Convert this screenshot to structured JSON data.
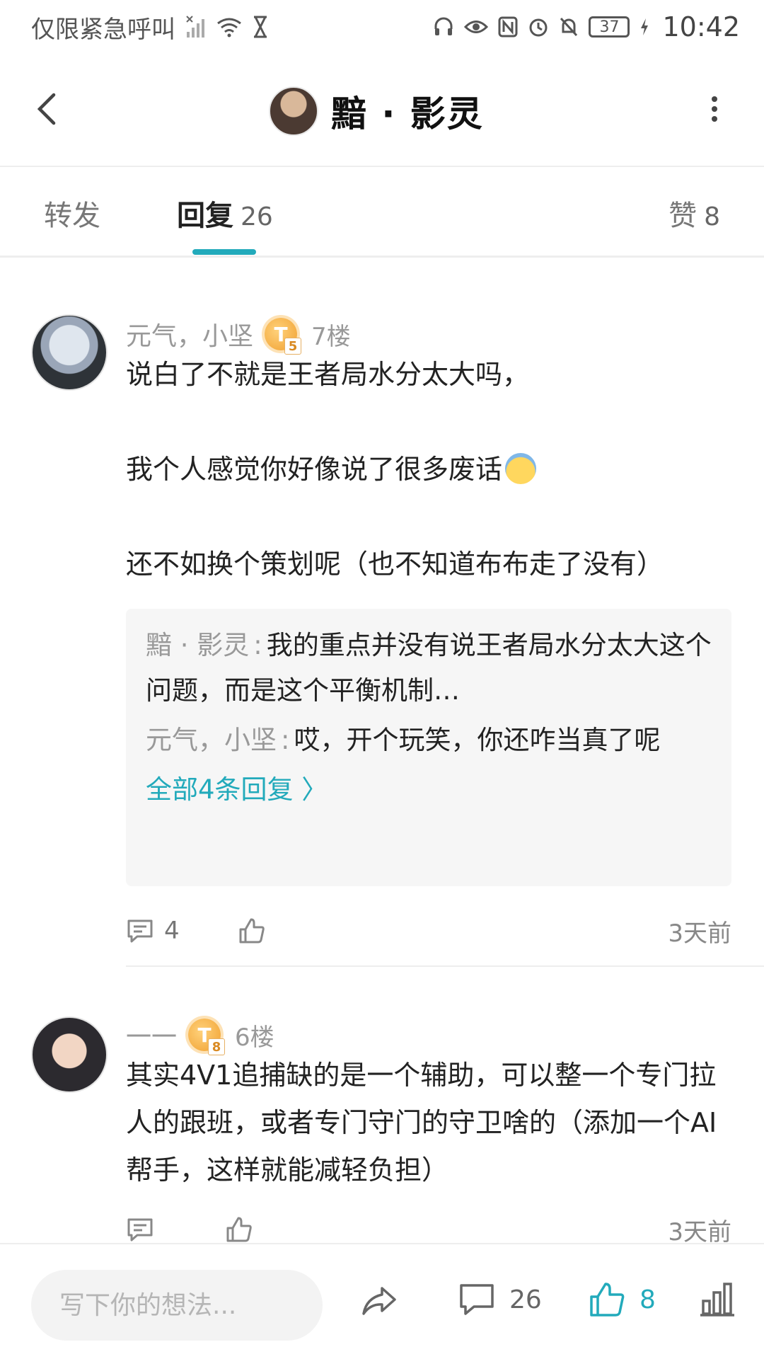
{
  "status_bar": {
    "carrier": "仅限紧急呼叫",
    "battery": "37",
    "time": "10:42"
  },
  "header": {
    "title": "黯 · 影灵",
    "avatar_icon": "user-avatar",
    "back_icon": "chevron-left-icon",
    "more_icon": "more-vertical-icon"
  },
  "tabs": {
    "forward": "转发",
    "replies": "回复",
    "replies_count": "26",
    "likes": "赞",
    "likes_count": "8",
    "accent": "#22aabb"
  },
  "comments": [
    {
      "author": "元气，小坚",
      "level_badge": "T",
      "level": "5",
      "floor": "7楼",
      "paragraphs": [
        "说白了不就是王者局水分太大吗，",
        "我个人感觉你好像说了很多废话",
        "还不如换个策划呢（也不知道布布走了没有）"
      ],
      "replies": [
        {
          "author": "黯 · 影灵",
          "separator": ":",
          "text": "我的重点并没有说王者局水分太大这个问题，而是这个平衡机制…"
        },
        {
          "author": "元气，小坚",
          "separator": ":",
          "text": "哎，开个玩笑，你还咋当真了呢"
        }
      ],
      "all_replies": "全部4条回复 〉",
      "reply_count": "4",
      "time": "3天前"
    },
    {
      "author": "一一",
      "level_badge": "T",
      "level": "8",
      "floor": "6楼",
      "paragraphs": [
        "其实4V1追捕缺的是一个辅助，可以整一个专门拉人的跟班，或者专门守门的守卫啥的（添加一个AI帮手，这样就能减轻负担）"
      ],
      "time": "3天前"
    }
  ],
  "bottom_bar": {
    "input_placeholder": "写下你的想法...",
    "comment_count": "26",
    "like_count": "8"
  }
}
